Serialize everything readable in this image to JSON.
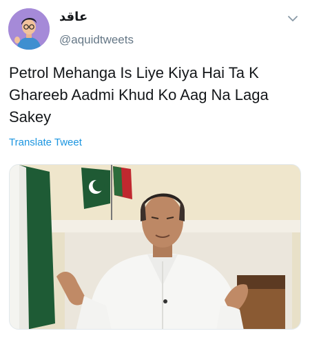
{
  "user": {
    "display_name": "عاقد",
    "handle": "@aquidtweets"
  },
  "tweet": {
    "text": "Petrol Mehanga Is Liye Kiya Hai Ta K Ghareeb Aadmi Khud Ko Aag Na Laga Sakey",
    "translate_label": "Translate Tweet"
  },
  "icons": {
    "caret": "chevron-down-icon",
    "avatar": "avatar-illustration",
    "media": "photo-man-speaking-with-flags"
  },
  "colors": {
    "link": "#1b95e0",
    "secondary_text": "#657786",
    "avatar_bg": "#a58ad8"
  }
}
